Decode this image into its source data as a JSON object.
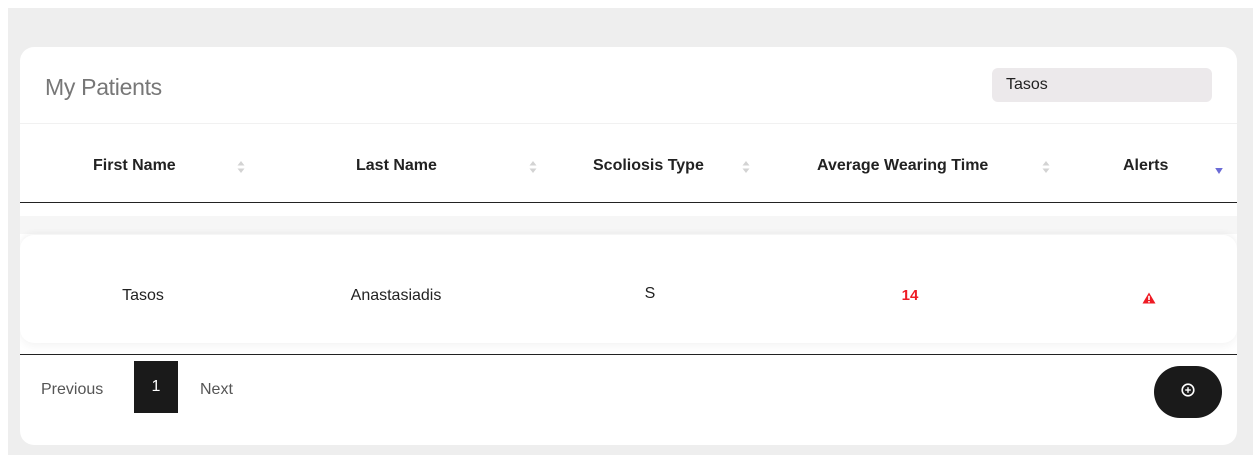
{
  "panel": {
    "title": "My Patients"
  },
  "search": {
    "value": "Tasos",
    "placeholder": ""
  },
  "table": {
    "columns": [
      {
        "label": "First Name",
        "sort_icon": "sort-both-icon"
      },
      {
        "label": "Last Name",
        "sort_icon": "sort-both-icon"
      },
      {
        "label": "Scoliosis Type",
        "sort_icon": "sort-both-icon"
      },
      {
        "label": "Average Wearing Time",
        "sort_icon": "sort-both-icon"
      },
      {
        "label": "Alerts",
        "sort_icon": "sort-desc-icon"
      }
    ],
    "rows": [
      {
        "first_name": "Tasos",
        "last_name": "Anastasiadis",
        "scoliosis_type": "S",
        "average_wearing_time": "14",
        "alert_icon": "warning-triangle-icon"
      }
    ]
  },
  "pagination": {
    "previous_label": "Previous",
    "current_page": "1",
    "next_label": "Next"
  },
  "actions": {
    "add_icon": "plus-circle-icon"
  },
  "colors": {
    "page_background": "#eeeeee",
    "card_background": "#ffffff",
    "search_background": "#ece9eb",
    "accent_dark": "#1a1a1a",
    "alert_red": "#ee1b24",
    "active_sort": "#6b6bd6",
    "inactive_sort": "#d3d3d3"
  }
}
